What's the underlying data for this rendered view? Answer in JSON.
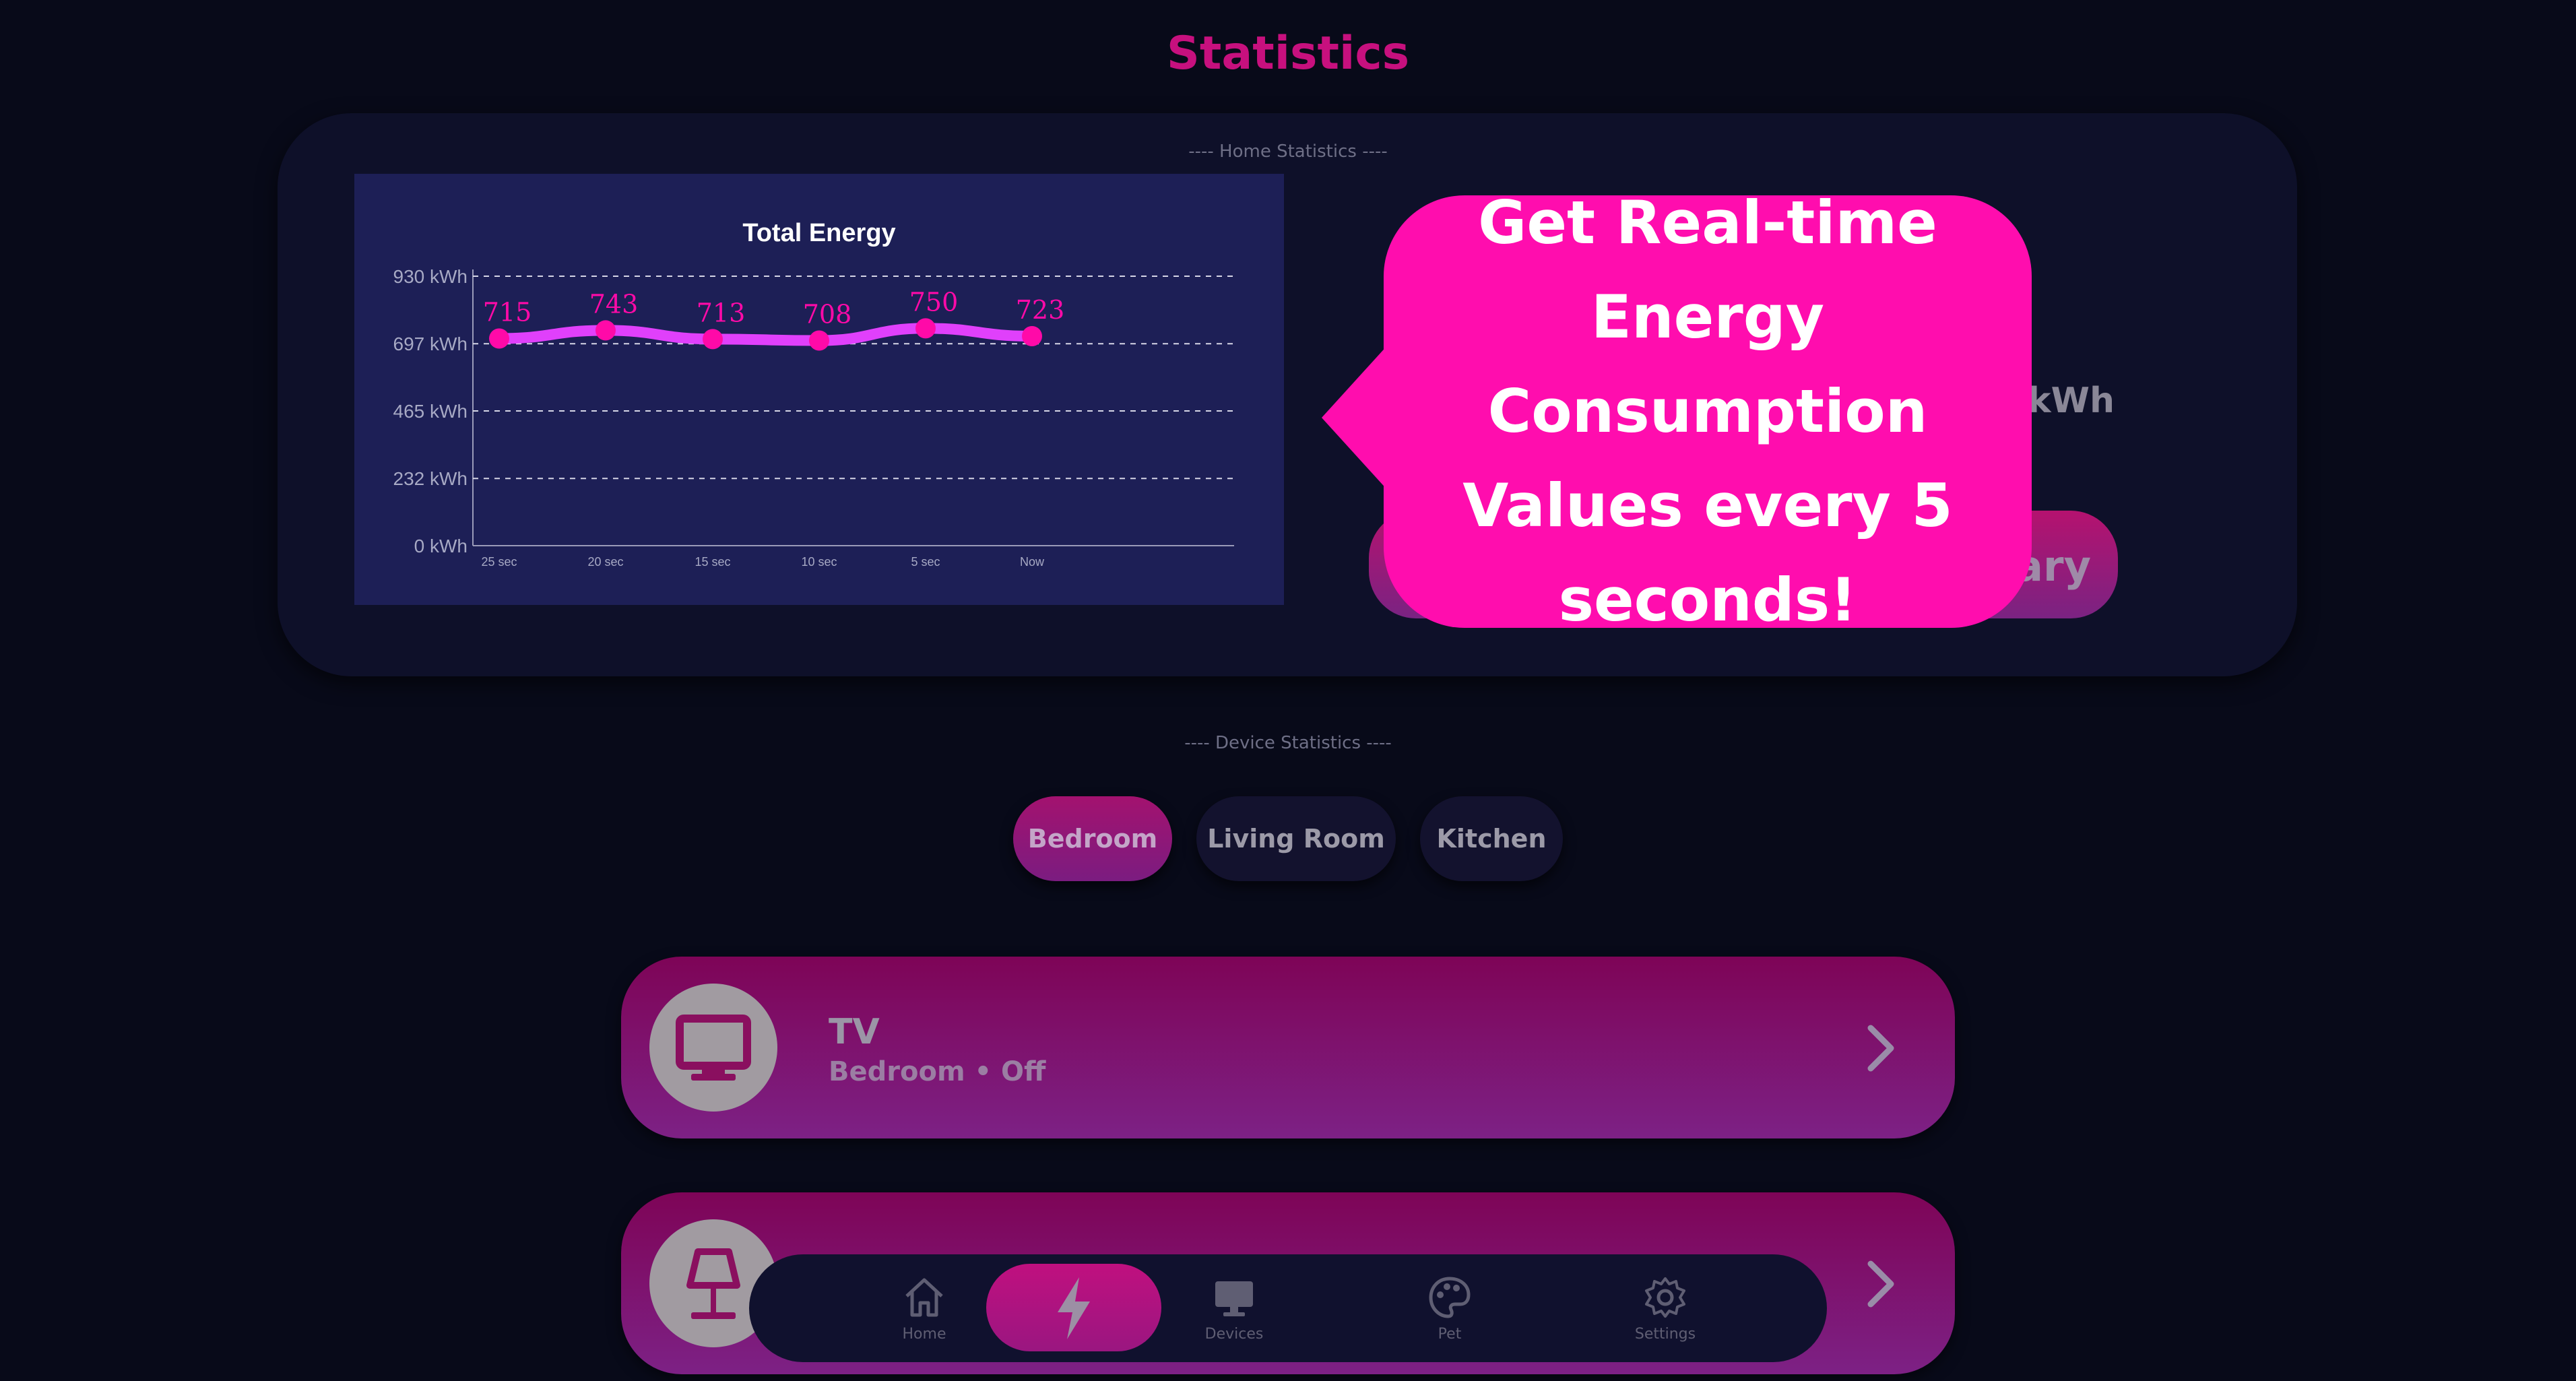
{
  "page": {
    "title": "Statistics"
  },
  "home_stats": {
    "section_label": "---- Home Statistics ----",
    "partial_value_unit": "kWh",
    "partial_button_text": "ary"
  },
  "chart_data": {
    "type": "line",
    "title": "Total Energy",
    "x": [
      "25 sec",
      "20 sec",
      "15 sec",
      "10 sec",
      "5 sec",
      "Now"
    ],
    "values": [
      715,
      743,
      713,
      708,
      750,
      723
    ],
    "ylim": [
      0,
      930
    ],
    "yticks": [
      "930 kWh",
      "697 kWh",
      "465 kWh",
      "232 kWh",
      "0 kWh"
    ],
    "ytick_values": [
      930,
      697,
      465,
      232,
      0
    ],
    "grid": true,
    "line_color": "#e040fb",
    "point_color": "#ff0aa8",
    "label_color": "#ff0aa8"
  },
  "callout": {
    "text": "Get Real-time Energy Consumption Values every 5 seconds!"
  },
  "device_stats": {
    "section_label": "---- Device Statistics ----",
    "tabs": [
      {
        "label": "Bedroom",
        "active": true
      },
      {
        "label": "Living Room",
        "active": false
      },
      {
        "label": "Kitchen",
        "active": false
      }
    ]
  },
  "devices": [
    {
      "name": "TV",
      "subtitle": "Bedroom • Off",
      "icon": "tv-icon"
    },
    {
      "name": "",
      "subtitle": "",
      "icon": "lamp-icon"
    }
  ],
  "nav": {
    "items": [
      {
        "label": "Home",
        "icon": "home-icon"
      },
      {
        "label": "",
        "icon": "lightning-icon",
        "active": true
      },
      {
        "label": "Devices",
        "icon": "monitor-icon"
      },
      {
        "label": "Pet",
        "icon": "palette-icon"
      },
      {
        "label": "Settings",
        "icon": "gear-icon"
      }
    ]
  },
  "colors": {
    "background": "#080a19",
    "accent": "#c7107e",
    "callout": "#ff0dae"
  }
}
